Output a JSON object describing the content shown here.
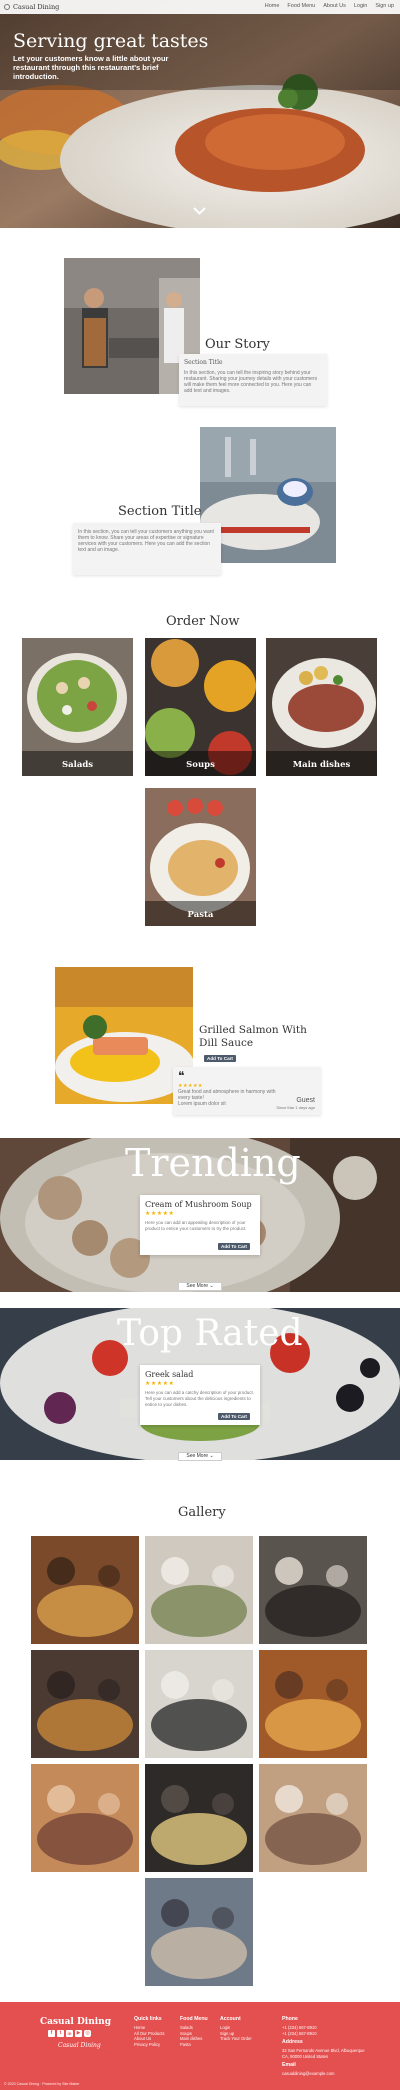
{
  "header": {
    "brand": "Casual Dining",
    "nav": [
      "Home",
      "Food Menu",
      "About Us",
      "Login",
      "Sign up"
    ]
  },
  "hero": {
    "title": "Serving great tastes",
    "subtitle": "Let your customers know a little about your restaurant through this restaurant's brief introduction."
  },
  "story": {
    "title": "Our Story",
    "card_title": "Section Title",
    "card_text": "In this section, you can tell the inspiring story behind your restaurant. Sharing your journey details with your customers will make them feel more connected to you. Here you can add text and images."
  },
  "section2": {
    "title": "Section Title",
    "card_text": "In this section, you can tell your customers anything you want them to know. Share your areas of expertise or signature services with your customers. Here you can add the section text and an image."
  },
  "order": {
    "title": "Order Now",
    "categories": [
      "Salads",
      "Soups",
      "Main dishes",
      "Pasta"
    ]
  },
  "featured": {
    "title": "Grilled Salmon With Dill Sauce",
    "button": "Add To Cart",
    "quote_icon": "quote-icon",
    "rating": "★★★★★",
    "review": "Great food and atmosphere in harmony with every taste!",
    "review_more": "Lorem ipsum dolor sit",
    "reviewer": "Guest",
    "review_date": "Since Mar 1 days ago"
  },
  "trending": {
    "title": "Trending",
    "card_title": "Cream of Mushroom Soup",
    "rating": "★★★★★",
    "card_text": "Here you can add an appealing description of your product to entice your customers to try the product.",
    "button": "Add To Cart",
    "see_more": "See More"
  },
  "top_rated": {
    "title": "Top Rated",
    "card_title": "Greek salad",
    "rating": "★★★★★",
    "card_text": "Here you can add a catchy description of your product. Tell your customers about the delicious ingredients to entice to your dishes.",
    "button": "Add To Cart",
    "see_more": "See More"
  },
  "gallery": {
    "title": "Gallery"
  },
  "footer": {
    "brand": "Casual Dining",
    "social_icons": [
      "facebook-icon",
      "twitter-icon",
      "linkedin-icon",
      "youtube-icon",
      "instagram-icon"
    ],
    "signature": "Casual Dining",
    "columns": [
      {
        "title": "Quick links",
        "items": [
          "Home",
          "All Our Products",
          "About Us",
          "Privacy Policy"
        ]
      },
      {
        "title": "Food Menu",
        "items": [
          "Salads",
          "Soups",
          "Main dishes",
          "Pasta"
        ]
      },
      {
        "title": "Account",
        "items": [
          "Login",
          "Sign up",
          "Track Your Order"
        ]
      }
    ],
    "contact": {
      "phone_title": "Phone",
      "phone_1": "+1 (234) 567-8910",
      "phone_2": "+1 (234) 567-8910",
      "address_title": "Address",
      "address": "32 San Fernando Avenue Blvd, Albuquerque CA, 90000 United States",
      "email_title": "Email",
      "email": "casualdining@example.com"
    },
    "copyright": "© 2023 Casual Dining · Powered by Site Maker"
  },
  "colors": {
    "footer_bg": "#e45050",
    "button_bg": "#4c5a6b",
    "star": "#f5b301"
  }
}
